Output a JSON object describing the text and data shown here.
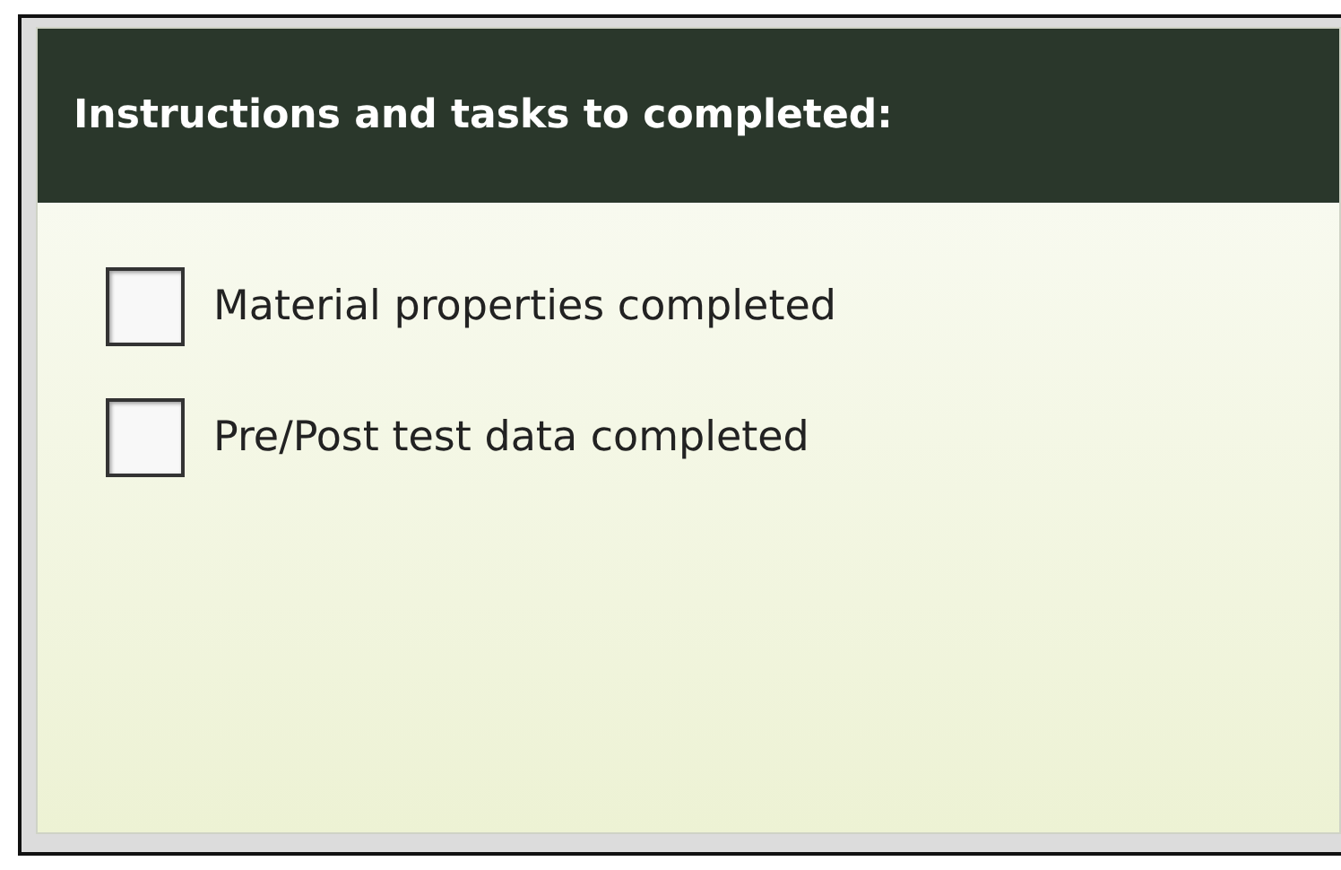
{
  "panel": {
    "title": "Instructions and tasks to completed:"
  },
  "tasks": [
    {
      "label": "Material properties completed",
      "checked": false
    },
    {
      "label": "Pre/Post test data completed",
      "checked": false
    }
  ]
}
